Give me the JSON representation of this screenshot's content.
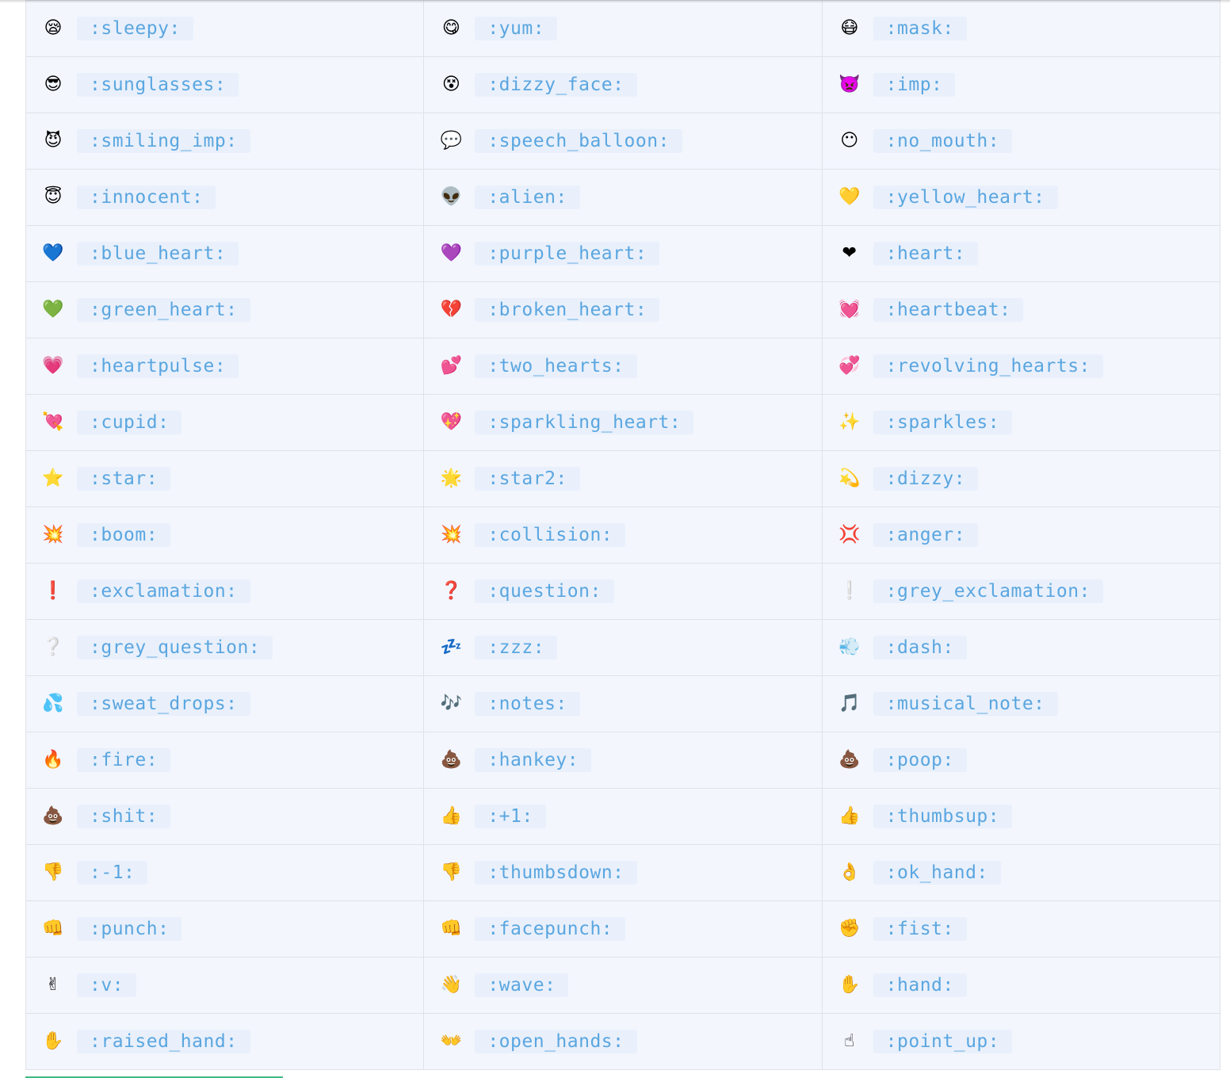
{
  "colors": {
    "cell_bg": "#f3f6fd",
    "code_bg": "#e9f0fb",
    "code_text": "#5aa6e0",
    "border": "#dfe2e5",
    "progress": "#42b983"
  },
  "rows": [
    [
      {
        "emoji": "😪",
        "code": ":sleepy:"
      },
      {
        "emoji": "😋",
        "code": ":yum:"
      },
      {
        "emoji": "😷",
        "code": ":mask:"
      }
    ],
    [
      {
        "emoji": "😎",
        "code": ":sunglasses:"
      },
      {
        "emoji": "😵",
        "code": ":dizzy_face:"
      },
      {
        "emoji": "👿",
        "code": ":imp:"
      }
    ],
    [
      {
        "emoji": "😈",
        "code": ":smiling_imp:"
      },
      {
        "emoji": "💬",
        "code": ":speech_balloon:"
      },
      {
        "emoji": "😶",
        "code": ":no_mouth:"
      }
    ],
    [
      {
        "emoji": "😇",
        "code": ":innocent:"
      },
      {
        "emoji": "👽",
        "code": ":alien:"
      },
      {
        "emoji": "💛",
        "code": ":yellow_heart:"
      }
    ],
    [
      {
        "emoji": "💙",
        "code": ":blue_heart:"
      },
      {
        "emoji": "💜",
        "code": ":purple_heart:"
      },
      {
        "emoji": "❤",
        "code": ":heart:"
      }
    ],
    [
      {
        "emoji": "💚",
        "code": ":green_heart:"
      },
      {
        "emoji": "💔",
        "code": ":broken_heart:"
      },
      {
        "emoji": "💓",
        "code": ":heartbeat:"
      }
    ],
    [
      {
        "emoji": "💗",
        "code": ":heartpulse:"
      },
      {
        "emoji": "💕",
        "code": ":two_hearts:"
      },
      {
        "emoji": "💞",
        "code": ":revolving_hearts:"
      }
    ],
    [
      {
        "emoji": "💘",
        "code": ":cupid:"
      },
      {
        "emoji": "💖",
        "code": ":sparkling_heart:"
      },
      {
        "emoji": "✨",
        "code": ":sparkles:"
      }
    ],
    [
      {
        "emoji": "⭐",
        "code": ":star:"
      },
      {
        "emoji": "🌟",
        "code": ":star2:"
      },
      {
        "emoji": "💫",
        "code": ":dizzy:"
      }
    ],
    [
      {
        "emoji": "💥",
        "code": ":boom:"
      },
      {
        "emoji": "💥",
        "code": ":collision:"
      },
      {
        "emoji": "💢",
        "code": ":anger:"
      }
    ],
    [
      {
        "emoji": "❗",
        "code": ":exclamation:"
      },
      {
        "emoji": "❓",
        "code": ":question:"
      },
      {
        "emoji": "❕",
        "code": ":grey_exclamation:"
      }
    ],
    [
      {
        "emoji": "❔",
        "code": ":grey_question:"
      },
      {
        "emoji": "💤",
        "code": ":zzz:"
      },
      {
        "emoji": "💨",
        "code": ":dash:"
      }
    ],
    [
      {
        "emoji": "💦",
        "code": ":sweat_drops:"
      },
      {
        "emoji": "🎶",
        "code": ":notes:"
      },
      {
        "emoji": "🎵",
        "code": ":musical_note:"
      }
    ],
    [
      {
        "emoji": "🔥",
        "code": ":fire:"
      },
      {
        "emoji": "💩",
        "code": ":hankey:"
      },
      {
        "emoji": "💩",
        "code": ":poop:"
      }
    ],
    [
      {
        "emoji": "💩",
        "code": ":shit:"
      },
      {
        "emoji": "👍",
        "code": ":+1:"
      },
      {
        "emoji": "👍",
        "code": ":thumbsup:"
      }
    ],
    [
      {
        "emoji": "👎",
        "code": ":-1:"
      },
      {
        "emoji": "👎",
        "code": ":thumbsdown:"
      },
      {
        "emoji": "👌",
        "code": ":ok_hand:"
      }
    ],
    [
      {
        "emoji": "👊",
        "code": ":punch:"
      },
      {
        "emoji": "👊",
        "code": ":facepunch:"
      },
      {
        "emoji": "✊",
        "code": ":fist:"
      }
    ],
    [
      {
        "emoji": "✌",
        "code": ":v:"
      },
      {
        "emoji": "👋",
        "code": ":wave:"
      },
      {
        "emoji": "✋",
        "code": ":hand:"
      }
    ],
    [
      {
        "emoji": "✋",
        "code": ":raised_hand:"
      },
      {
        "emoji": "👐",
        "code": ":open_hands:"
      },
      {
        "emoji": "☝",
        "code": ":point_up:"
      }
    ]
  ]
}
